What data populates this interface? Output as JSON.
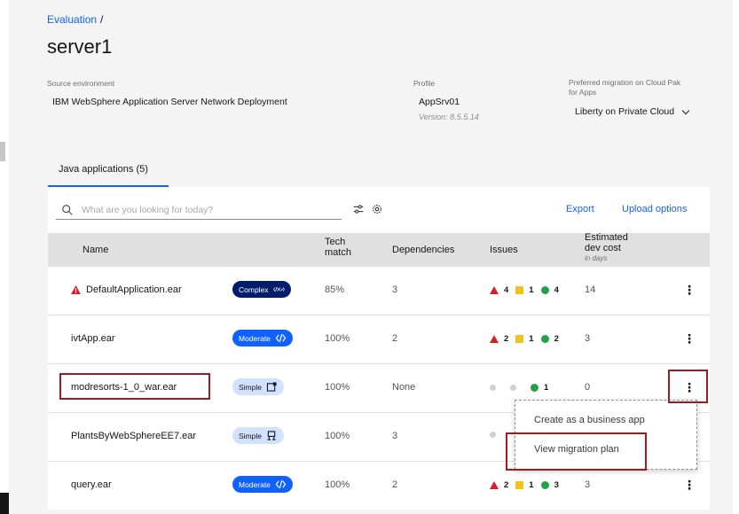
{
  "breadcrumb": {
    "parent": "Evaluation",
    "separator": "/"
  },
  "page_title": "server1",
  "info": {
    "source_label": "Source environment",
    "source_value": "IBM WebSphere Application Server Network Deployment",
    "profile_label": "Profile",
    "profile_value": "AppSrv01",
    "profile_version": "Version: 8.5.5.14",
    "pref_label_line1": "Preferred migration on Cloud Pak",
    "pref_label_line2": "for Apps",
    "pref_value": "Liberty on Private Cloud"
  },
  "tab": {
    "label": "Java applications (5)"
  },
  "toolbar": {
    "search_placeholder": "What are you looking for today?",
    "export_label": "Export",
    "upload_label": "Upload options"
  },
  "table": {
    "headers": {
      "name": "Name",
      "tech_match_1": "Tech",
      "tech_match_2": "match",
      "dependencies": "Dependencies",
      "issues": "Issues",
      "cost_1": "Estimated",
      "cost_2": "dev cost",
      "cost_sub": "in days"
    },
    "rows": [
      {
        "name": "DefaultApplication.ear",
        "complexity": "Complex",
        "tech_match": "85%",
        "dependencies": "3",
        "critical": "4",
        "warning": "1",
        "info": "4",
        "cost": "14"
      },
      {
        "name": "ivtApp.ear",
        "complexity": "Moderate",
        "tech_match": "100%",
        "dependencies": "2",
        "critical": "2",
        "warning": "1",
        "info": "2",
        "cost": "3"
      },
      {
        "name": "modresorts-1_0_war.ear",
        "complexity": "Simple",
        "tech_match": "100%",
        "dependencies": "None",
        "critical": "",
        "warning": "",
        "info": "1",
        "cost": "0"
      },
      {
        "name": "PlantsByWebSphereEE7.ear",
        "complexity": "Simple",
        "tech_match": "100%",
        "dependencies": "3",
        "critical": "",
        "warning": "",
        "info": "",
        "cost": ""
      },
      {
        "name": "query.ear",
        "complexity": "Moderate",
        "tech_match": "100%",
        "dependencies": "2",
        "critical": "2",
        "warning": "1",
        "info": "3",
        "cost": "3"
      }
    ]
  },
  "overflow_menu": {
    "items": [
      "Create as a business app",
      "View migration plan"
    ]
  },
  "colors": {
    "accent": "#0f62fe",
    "critical": "#da1e28",
    "warning": "#f1c21b",
    "info": "#24a148",
    "highlight": "#a2191f"
  }
}
